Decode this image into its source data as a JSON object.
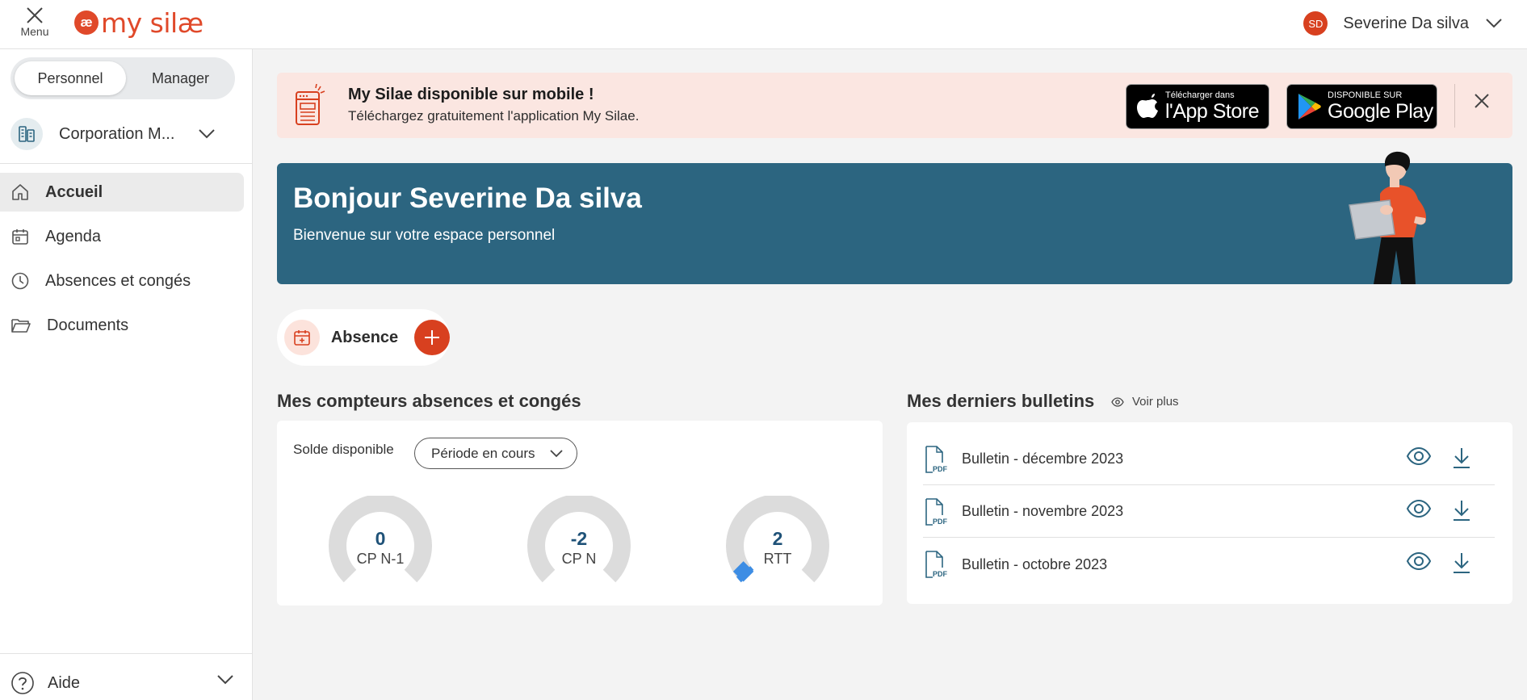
{
  "topbar": {
    "menu_label": "Menu",
    "logo_mark": "æ",
    "logo_text": "my silæ",
    "user_initials": "SD",
    "user_name": "Severine Da silva"
  },
  "sidebar": {
    "roles": [
      "Personnel",
      "Manager"
    ],
    "active_role": "Personnel",
    "company": "Corporation M...",
    "nav": [
      {
        "label": "Accueil",
        "icon": "home-icon",
        "active": true
      },
      {
        "label": "Agenda",
        "icon": "calendar-icon",
        "active": false
      },
      {
        "label": "Absences et congés",
        "icon": "clock-icon",
        "active": false
      },
      {
        "label": "Documents",
        "icon": "folder-icon",
        "active": false
      }
    ],
    "help_label": "Aide"
  },
  "banner": {
    "title": "My Silae disponible sur mobile !",
    "subtitle": "Téléchargez gratuitement l'application My Silae.",
    "apple_small": "Télécharger dans",
    "apple_big": "l'App Store",
    "google_small": "DISPONIBLE SUR",
    "google_big": "Google Play"
  },
  "hero": {
    "title": "Bonjour Severine Da silva",
    "subtitle": "Bienvenue sur votre espace personnel"
  },
  "absence": {
    "label": "Absence"
  },
  "counters": {
    "title": "Mes compteurs absences et congés",
    "solde_label": "Solde disponible",
    "period": "Période en cours",
    "gauges": [
      {
        "value": "0",
        "label": "CP N-1",
        "fraction": 0
      },
      {
        "value": "-2",
        "label": "CP N",
        "fraction": 0
      },
      {
        "value": "2",
        "label": "RTT",
        "fraction": 0.03
      }
    ],
    "colors": {
      "track": "#dcdcdc",
      "fill": "#3d8de4"
    }
  },
  "bulletins": {
    "title": "Mes derniers bulletins",
    "voir_plus": "Voir plus",
    "pdf_label": "PDF",
    "items": [
      {
        "name": "Bulletin - décembre 2023"
      },
      {
        "name": "Bulletin - novembre 2023"
      },
      {
        "name": "Bulletin - octobre 2023"
      }
    ]
  }
}
